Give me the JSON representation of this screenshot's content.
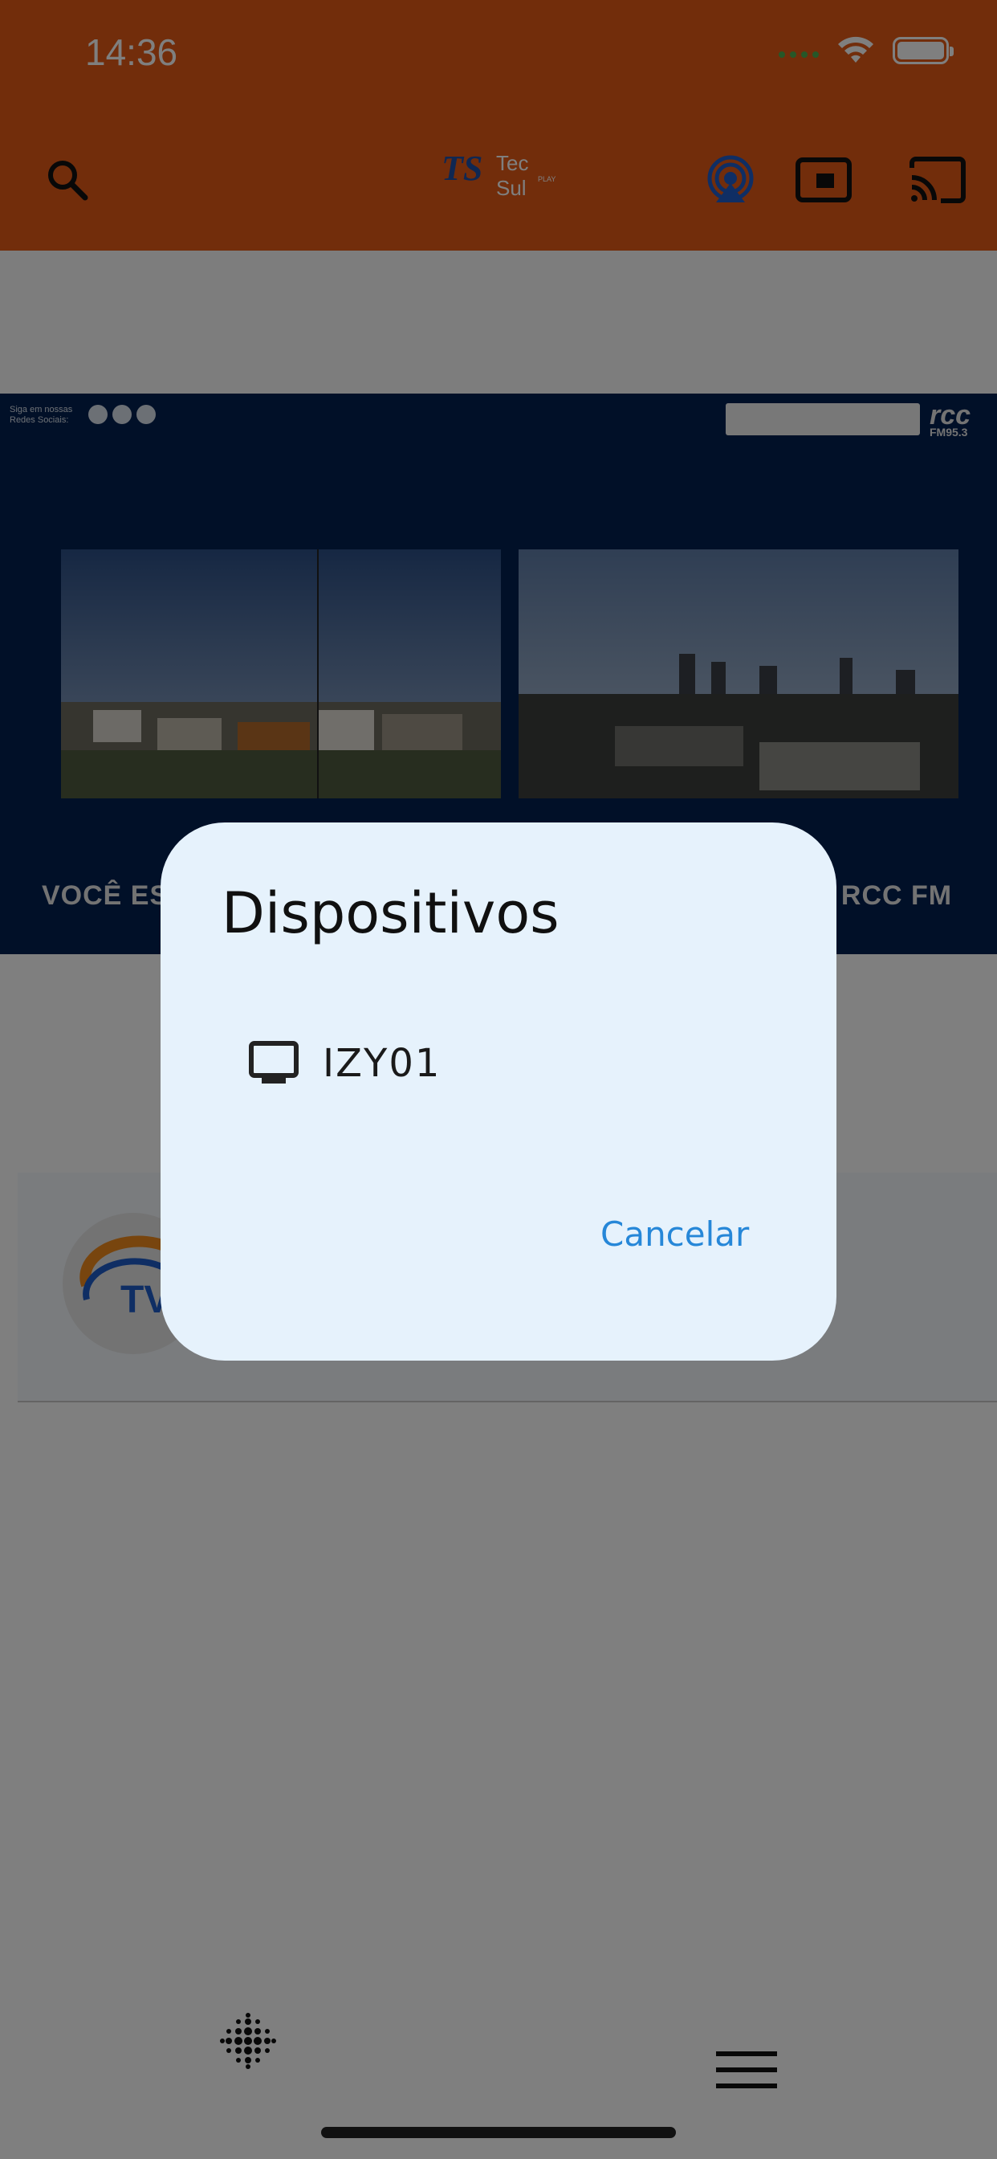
{
  "status_bar": {
    "time": "14:36"
  },
  "header": {
    "logo_mark": "TS",
    "logo_text": "Tec Sul",
    "logo_sub": "PLAY",
    "icons": [
      "search-icon",
      "airplay-audio-icon",
      "picture-in-picture-icon",
      "cast-icon"
    ],
    "accent_color": "#e45a17"
  },
  "banner": {
    "social_text": "Siga em nossas Redes Sociais:",
    "brand": "rcc",
    "brand_sub": "FM95.3",
    "caption_left": "VOCÊ EST",
    "caption_right": "O RCC FM"
  },
  "card": {
    "avatar_text": "TV"
  },
  "dialog": {
    "title": "Dispositivos",
    "devices": [
      {
        "name": "IZY01",
        "icon": "tv-icon"
      }
    ],
    "cancel_label": "Cancelar",
    "background": "#e6f2fc",
    "action_color": "#2687d8"
  },
  "bottom_bar": {
    "icons": [
      "dots-grid-icon",
      "menu-icon"
    ]
  }
}
